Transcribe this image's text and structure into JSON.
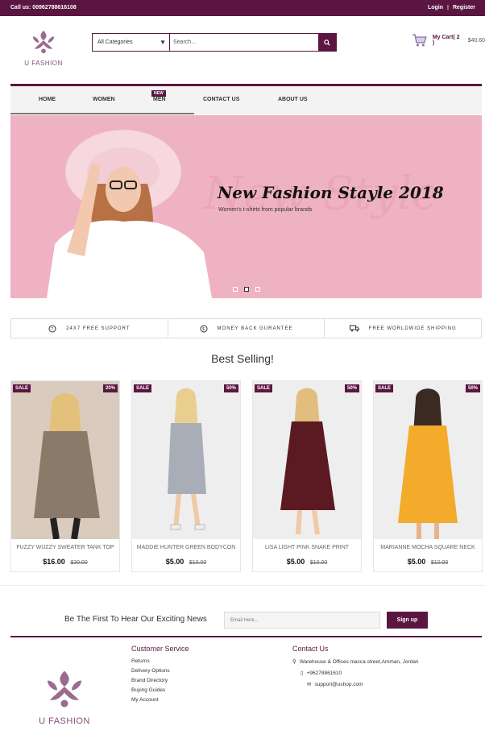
{
  "topbar": {
    "call": "Call us: 00962788616108",
    "login": "Login",
    "separator": "|",
    "register": "Register"
  },
  "brand": {
    "name": "U FASHION"
  },
  "search": {
    "category": "All Categories",
    "placeholder": "Search..."
  },
  "cart": {
    "label": "My Cart( 2 )",
    "amount": "$40.60"
  },
  "nav": {
    "items": [
      "HOME",
      "WOMEN",
      "MEN",
      "CONTACT US",
      "ABOUT US"
    ],
    "new_badge": "NEW"
  },
  "hero": {
    "title": "New Fashion Stayle 2018",
    "subtitle": "Women's t-shirts from popular brands",
    "ghost": "New Style"
  },
  "features": [
    "24X7 FREE SUPPORT",
    "MONEY BACK GURANTEE",
    "FREE WORLDWIDE SHIPPING"
  ],
  "section_title": "Best Selling!",
  "products": [
    {
      "sale": "SALE",
      "off": "20%",
      "title": "FUZZY WUZZY SWEATER TANK TOP",
      "price": "$16.00",
      "old": "$20.00"
    },
    {
      "sale": "SALE",
      "off": "50%",
      "title": "MADDIE HUNTER GREEN BODYCON",
      "price": "$5.00",
      "old": "$10.00"
    },
    {
      "sale": "SALE",
      "off": "50%",
      "title": "LISA LIGHT PINK SNAKE PRINT",
      "price": "$5.00",
      "old": "$10.00"
    },
    {
      "sale": "SALE",
      "off": "50%",
      "title": "MARIANNE MOCHA SQUARE NECK",
      "price": "$5.00",
      "old": "$10.00"
    }
  ],
  "newsletter": {
    "text": "Be The First To Hear Our Exciting News",
    "placeholder": "Email Here...",
    "button": "Sign up"
  },
  "footer": {
    "customer_service": {
      "title": "Customer Service",
      "links": [
        "Returns",
        "Delivery Options",
        "Brand Directory",
        "Buying Guides",
        "My Account"
      ]
    },
    "contact": {
      "title": "Contact Us",
      "address": "Warehouse & Offices macca street,Amman, Jordan",
      "phone": "+96278861610",
      "email": "support@ushop.com"
    }
  },
  "colors": {
    "primary": "#5a1640",
    "hero_bg": "#efb2c2"
  }
}
